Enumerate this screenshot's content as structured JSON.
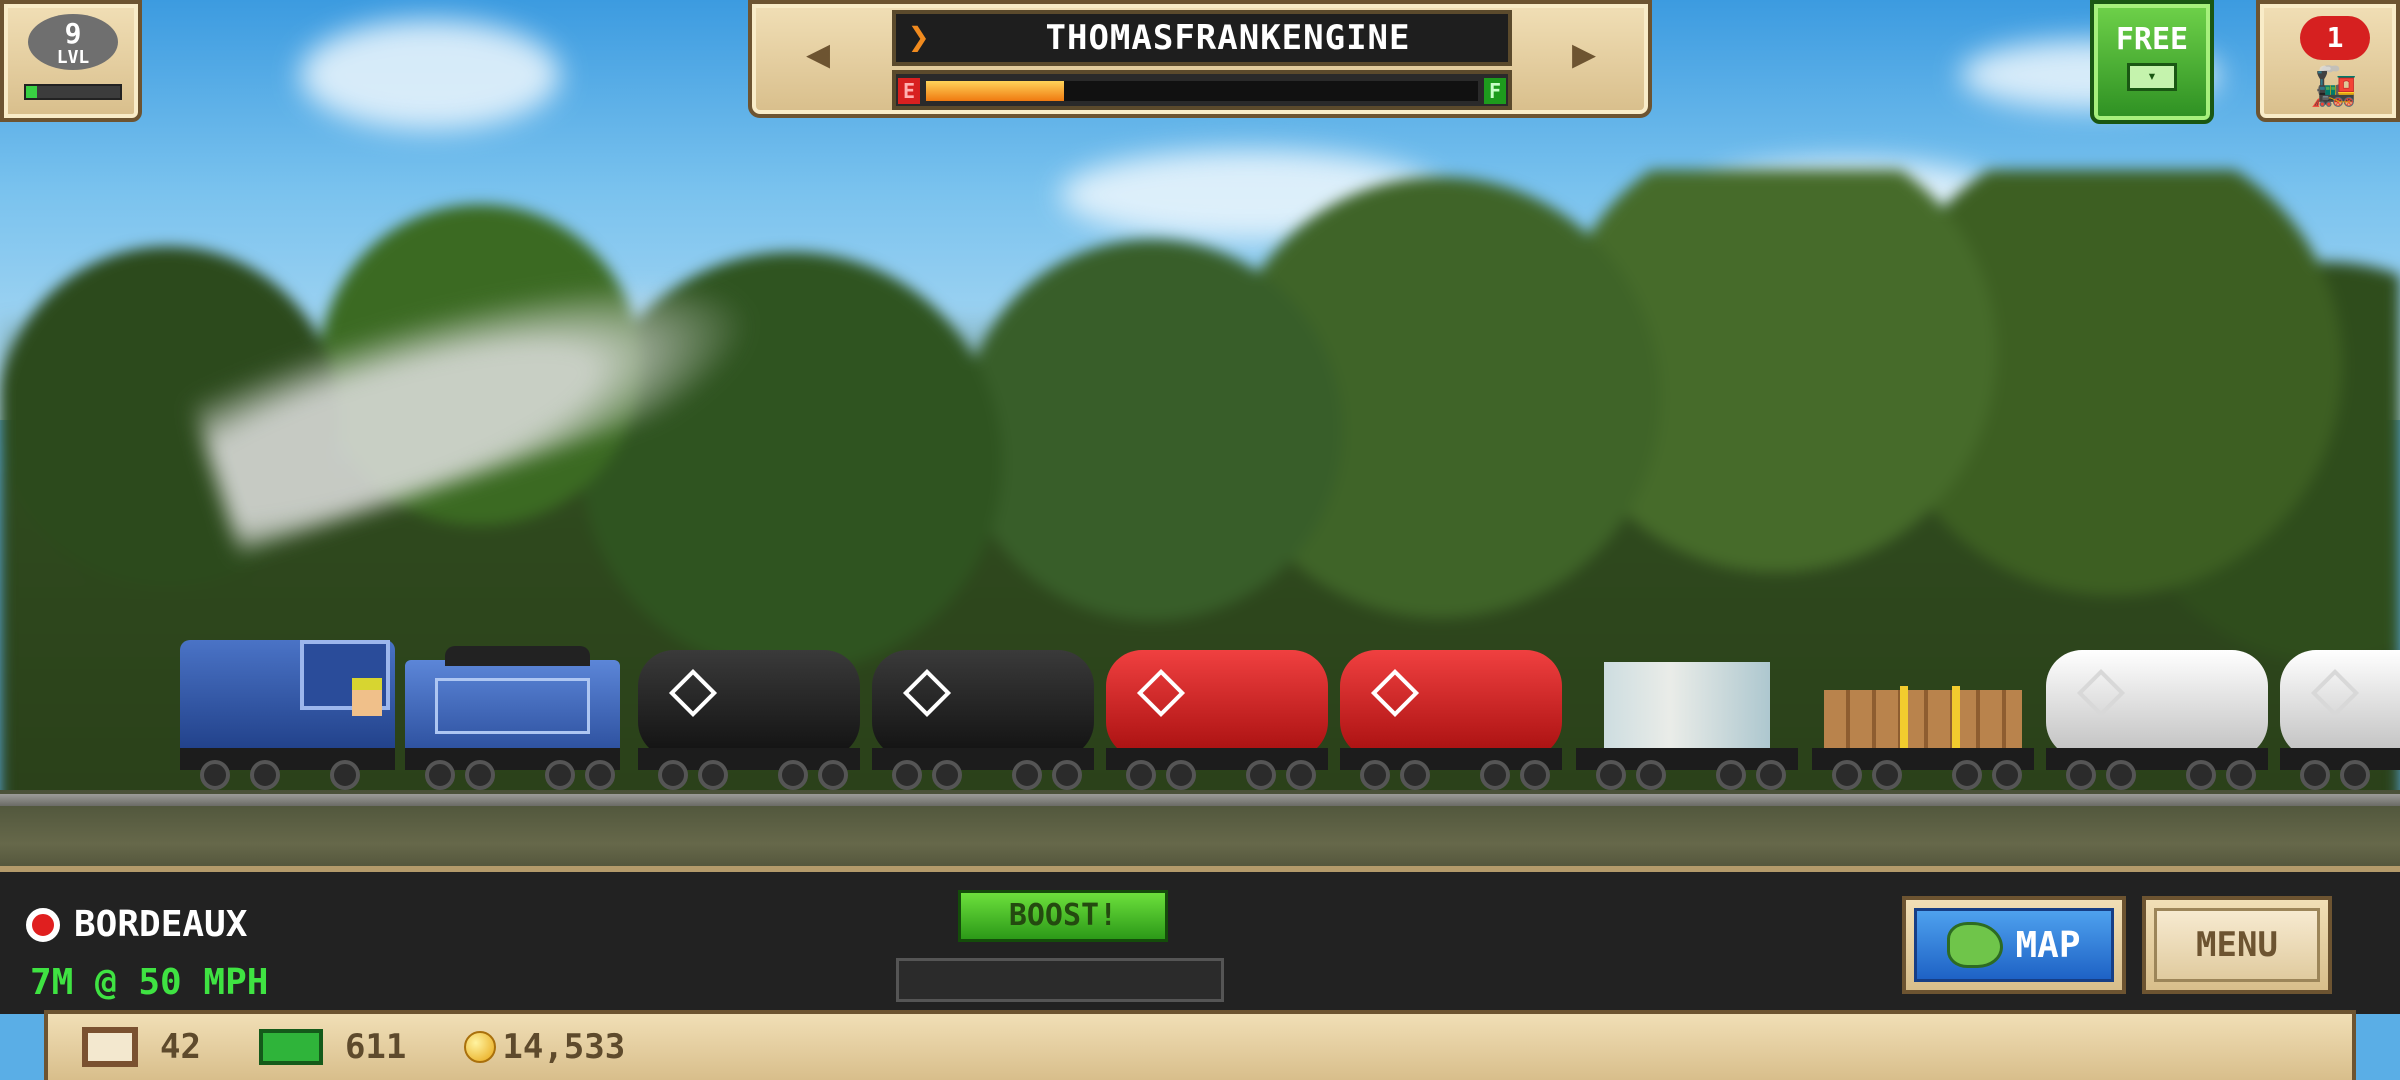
{
  "hud": {
    "level": {
      "value": "9",
      "label": "LVL",
      "progress": 0.12
    },
    "engine": {
      "name": "THOMASFRANKENGINE",
      "prev_icon": "left-arrow-icon",
      "next_icon": "right-arrow-icon",
      "fuel_empty_label": "E",
      "fuel_full_label": "F",
      "fuel_fraction": 0.25
    },
    "free_button": {
      "label": "FREE"
    },
    "train_badge": {
      "count": "1"
    }
  },
  "status": {
    "station": "BORDEAUX",
    "speed": "7M @ 50 MPH",
    "boost_label": "BOOST!",
    "boost_progress": 0
  },
  "buttons": {
    "map_label": "MAP",
    "menu_label": "MENU"
  },
  "resources": {
    "crates": "42",
    "cash": "611",
    "coins": "14,533"
  },
  "colors": {
    "accent_green": "#3fe342",
    "panel_beige": "#d8be8b",
    "alert_red": "#d62020"
  }
}
